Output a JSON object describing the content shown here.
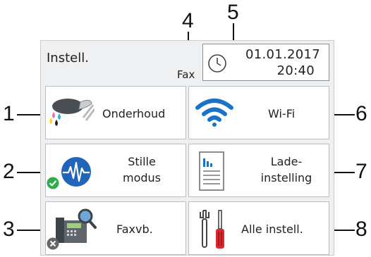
{
  "header": {
    "title": "Instell.",
    "mode": "Fax",
    "date": "01.01.2017",
    "time": "20:40"
  },
  "tiles": [
    {
      "label": "Onderhoud",
      "icon": "toner-icon"
    },
    {
      "label": "Wi-Fi",
      "icon": "wifi-icon"
    },
    {
      "label_line1": "Stille",
      "label_line2": "modus",
      "icon": "quiet-mode-icon",
      "status": "on"
    },
    {
      "label_line1": "Lade-",
      "label_line2": "instelling",
      "icon": "tray-document-icon"
    },
    {
      "label": "Faxvb.",
      "icon": "fax-preview-icon",
      "status": "off"
    },
    {
      "label": "Alle instell.",
      "icon": "tools-icon"
    }
  ],
  "callouts": [
    "1",
    "2",
    "3",
    "4",
    "5",
    "6",
    "7",
    "8"
  ],
  "colors": {
    "screen_bg": "#eef0f1",
    "wifi_blue": "#1a73c8",
    "status_green": "#2eac4a",
    "status_off": "#666666",
    "tool_red": "#d9282f"
  }
}
